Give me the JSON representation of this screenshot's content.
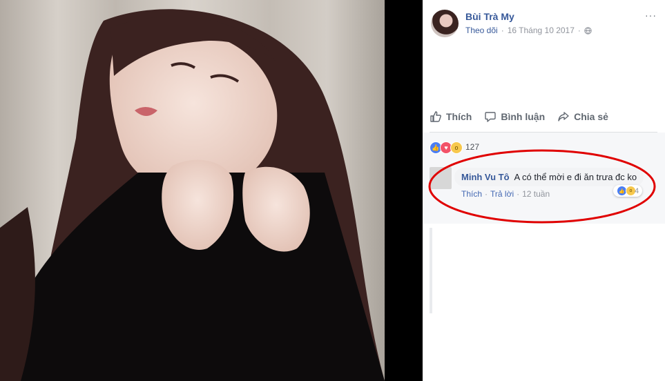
{
  "post": {
    "author": "Bùi Trà My",
    "follow_label": "Theo dõi",
    "separator": "·",
    "date": "16 Tháng 10 2017",
    "globe_icon": "globe-icon",
    "more": "···"
  },
  "actions": {
    "like": "Thích",
    "comment": "Bình luận",
    "share": "Chia sẻ"
  },
  "reactions": {
    "types": [
      "like",
      "love",
      "wow"
    ],
    "count": "127"
  },
  "comment": {
    "name": "Minh Vu Tô",
    "text": "A có thể mời e đi ăn trưa đc ko",
    "like_label": "Thích",
    "separator": "·",
    "reply_label": "Trả lời",
    "time": "12 tuần",
    "reaction_count": "4"
  },
  "colors": {
    "link": "#365899",
    "accent": "#4267b2",
    "highlight_ring": "#e00000",
    "like": "#4a7ef5",
    "love": "#f25268",
    "wow": "#f7c84d"
  }
}
